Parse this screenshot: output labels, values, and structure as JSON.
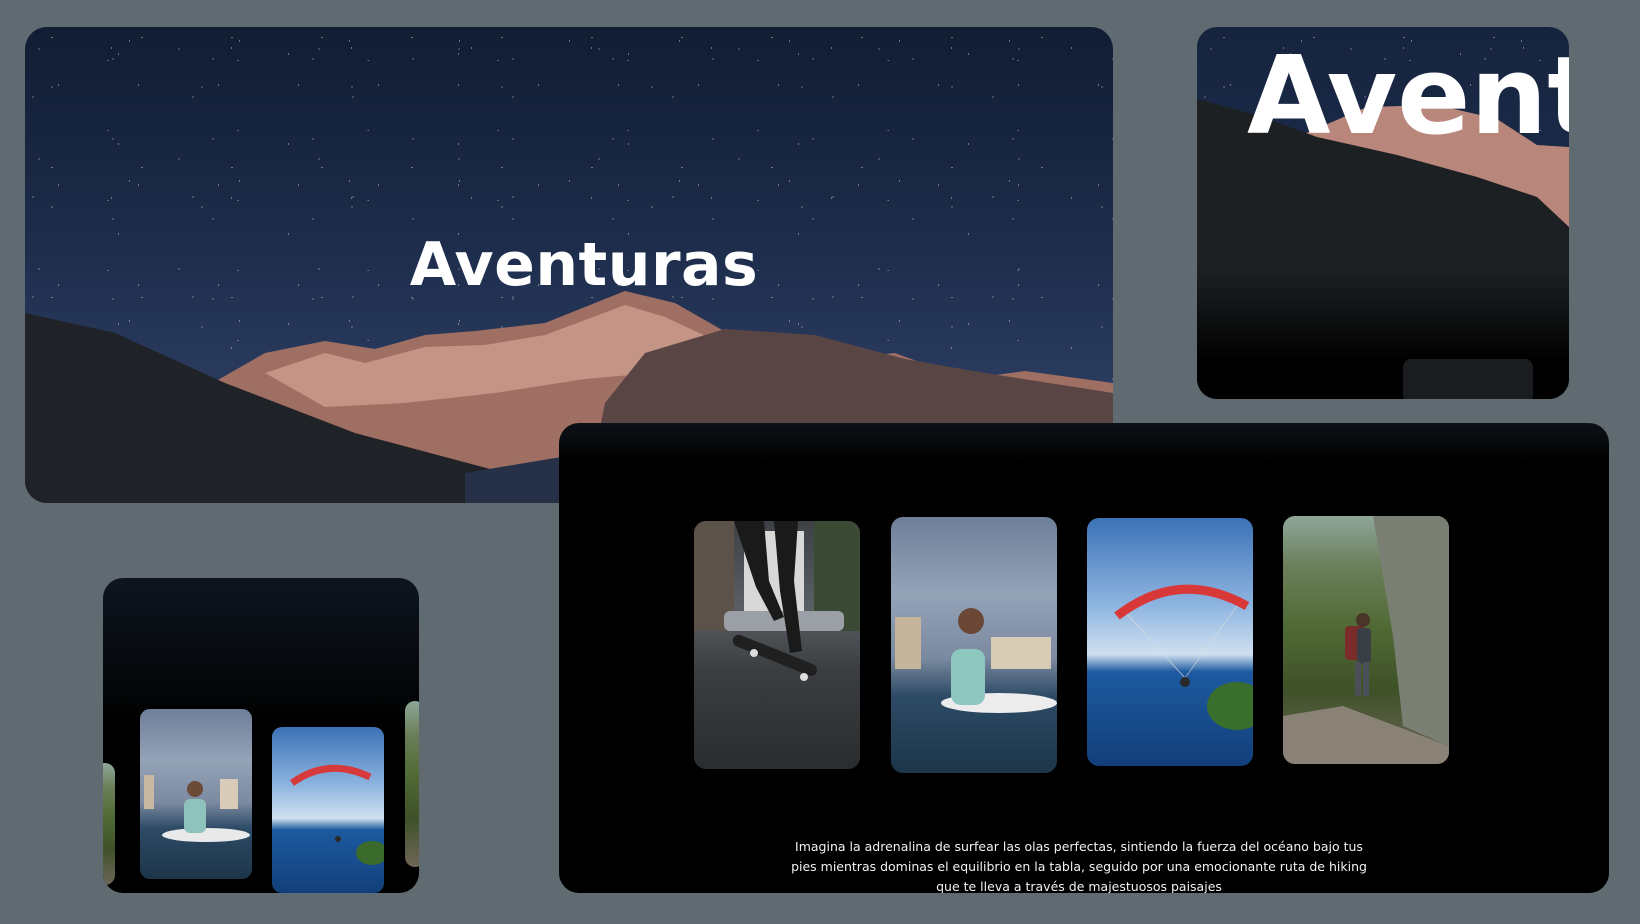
{
  "hero": {
    "title": "Aventuras"
  },
  "zoom": {
    "title": "Avent"
  },
  "gallery": {
    "cards": [
      {
        "name": "skateboarder"
      },
      {
        "name": "surfer"
      },
      {
        "name": "paraglider"
      },
      {
        "name": "hiker"
      }
    ],
    "description": "Imagina la adrenalina de surfear las olas perfectas, sintiendo la fuerza del océano bajo tus pies mientras dominas el equilibrio en la tabla, seguido por una emocionante ruta de hiking que te lleva a través de majestuosos paisajes"
  },
  "colors": {
    "page_background": "#5f6b71",
    "panel_dark": "#000000",
    "title_text": "#ffffff"
  }
}
